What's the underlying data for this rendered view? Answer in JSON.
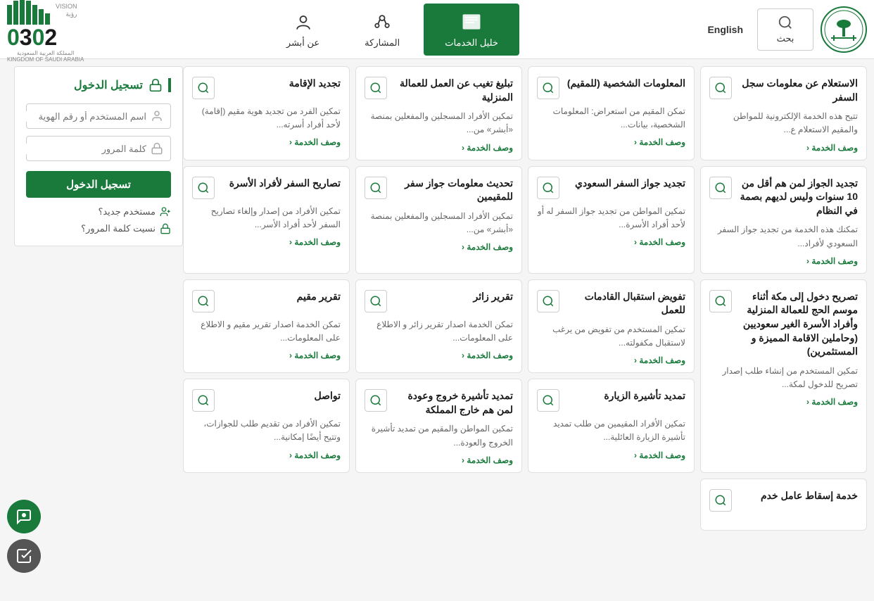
{
  "header": {
    "search_label": "بحث",
    "english_label": "English",
    "nav_items": [
      {
        "id": "services",
        "label": "خليل الخدمات",
        "active": true
      },
      {
        "id": "sharing",
        "label": "المشاركة",
        "active": false
      },
      {
        "id": "absher",
        "label": "عن أبشر",
        "active": false
      }
    ],
    "vision_text": "VISION رؤية",
    "year": "2030",
    "kingdom": "المملكة العربية السعودية\nKINGDOM OF SAUDI ARABIA"
  },
  "login": {
    "title": "تسجيل الدخول",
    "username_placeholder": "اسم المستخدم أو رقم الهوية",
    "password_placeholder": "كلمة المرور",
    "login_btn": "تسجيل الدخول",
    "new_user": "مستخدم جديد؟",
    "forgot_password": "نسيت كلمة المرور؟"
  },
  "cards": [
    {
      "id": "c1",
      "title": "الاستعلام عن معلومات سجل السفر",
      "desc": "تتيح هذه الخدمة الإلكترونية للمواطن والمقيم الاستعلام ع...",
      "link": "وصف الخدمة ‹"
    },
    {
      "id": "c2",
      "title": "المعلومات الشخصية (للمقيم)",
      "desc": "تمكن المقيم من استعراض: المعلومات الشخصية، بيانات...",
      "link": "وصف الخدمة ‹"
    },
    {
      "id": "c3",
      "title": "تبليغ تغيب عن العمل للعمالة المنزلية",
      "desc": "تمكين الأفراد المسجلين والمفعلين بمنصة «أبشر» من...",
      "link": "وصف الخدمة ‹"
    },
    {
      "id": "c4",
      "title": "تجديد الإقامة",
      "desc": "تمكين الفرد من تجديد هوية مقيم (إقامة) لأحد أفراد أسرته...",
      "link": "وصف الخدمة ‹"
    },
    {
      "id": "c5",
      "title": "تجديد الجواز لمن هم أقل من 10 سنوات وليس لديهم بصمة في النظام",
      "desc": "تمكنك هذه الخدمة من تجديد جواز السفر السعودي لأفراد...",
      "link": "وصف الخدمة ‹"
    },
    {
      "id": "c6",
      "title": "تجديد جواز السفر السعودي",
      "desc": "تمكين المواطن من تجديد جواز السفر له أو لأحد أفراد الأسرة...",
      "link": "وصف الخدمة ‹"
    },
    {
      "id": "c7",
      "title": "تحديث معلومات جواز سفر للمقيمين",
      "desc": "تمكين الأفراد المسجلين والمفعلين بمنصة «أبشر» من...",
      "link": "وصف الخدمة ‹"
    },
    {
      "id": "c8",
      "title": "تصاريح السفر لأفراد الأسرة",
      "desc": "تمكين الأفراد من إصدار وإلغاء تصاريح السفر لأحد أفراد الأسر...",
      "link": "وصف الخدمة ‹"
    },
    {
      "id": "c9",
      "title": "تصريح دخول إلى مكة أثناء موسم الحج للعمالة المنزلية وأفراد الأسرة الغير سعوديين (وحاملين الاقامة المميزة و المستثمرين)",
      "desc": "تمكين المستخدم من إنشاء طلب إصدار تصريح للدخول لمكة...",
      "link": "وصف الخدمة ‹",
      "tall": true
    },
    {
      "id": "c10",
      "title": "تفويض استقبال القادمات للعمل",
      "desc": "تمكين المستخدم من تفويض من يرغب لاستقبال مكفولته...",
      "link": "وصف الخدمة ‹"
    },
    {
      "id": "c11",
      "title": "تقرير زائر",
      "desc": "تمكن الخدمة اصدار تقرير زائر و الاطلاع على المعلومات...",
      "link": "وصف الخدمة ‹"
    },
    {
      "id": "c12",
      "title": "تقرير مقيم",
      "desc": "تمكن الخدمة اصدار تقرير مقيم و الاطلاع على المعلومات...",
      "link": "وصف الخدمة ‹"
    },
    {
      "id": "c13",
      "title": "تمديد تأشيرة الزيارة",
      "desc": "تمكين الأفراد المقيمين من طلب تمديد تأشيرة الزيارة العائلية...",
      "link": "وصف الخدمة ‹"
    },
    {
      "id": "c14",
      "title": "تمديد تأشيرة خروج وعودة لمن هم خارج المملكة",
      "desc": "تمكين المواطن والمقيم من تمديد تأشيرة الخروج والعودة...",
      "link": "وصف الخدمة ‹"
    },
    {
      "id": "c15",
      "title": "تواصل",
      "desc": "تمكين الأفراد من تقديم طلب للجوازات، وتتيح أيضًا إمكانية...",
      "link": "وصف الخدمة ‹"
    },
    {
      "id": "c16",
      "title": "خدمة إسقاط عامل خدم",
      "desc": "",
      "link": ""
    }
  ]
}
